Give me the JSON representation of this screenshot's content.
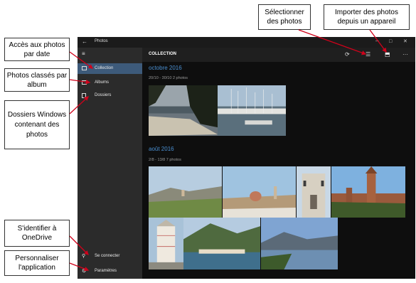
{
  "window": {
    "title": "Photos",
    "back": "←",
    "minimize": "─",
    "maximize": "□",
    "close": "✕"
  },
  "sidebar": {
    "menu_icon": "≡",
    "items": [
      {
        "label": "Collection",
        "icon": "collection-icon",
        "selected": true
      },
      {
        "label": "Albums",
        "icon": "albums-icon"
      },
      {
        "label": "Dossiers",
        "icon": "folder-icon"
      }
    ],
    "signin": {
      "label": "Se connecter",
      "icon": "person-icon"
    },
    "settings": {
      "label": "Paramètres",
      "icon": "gear-icon"
    }
  },
  "main": {
    "title": "COLLECTION",
    "commands": {
      "refresh": "⟳",
      "select": "☰",
      "import": "⬒",
      "more": "···"
    },
    "groups": [
      {
        "month": "octobre 2016",
        "range": "20/10 - 30/10   2 photos"
      },
      {
        "month": "août 2016",
        "range": "2/8 - 13/8   7 photos"
      }
    ]
  },
  "callouts": {
    "date": "Accès aux photos par date",
    "album": "Photos classés par album",
    "folders": "Dossiers Windows contenant des photos",
    "onedrive": "S'identifier à OneDrive",
    "personalize": "Personnaliser l'application",
    "select": "Sélectionner des photos",
    "import": "Importer des photos depuis un appareil"
  },
  "colors": {
    "accent": "#4a8fd1",
    "selected_nav": "#3d5a7a",
    "callout_arrow": "#d0021b"
  }
}
